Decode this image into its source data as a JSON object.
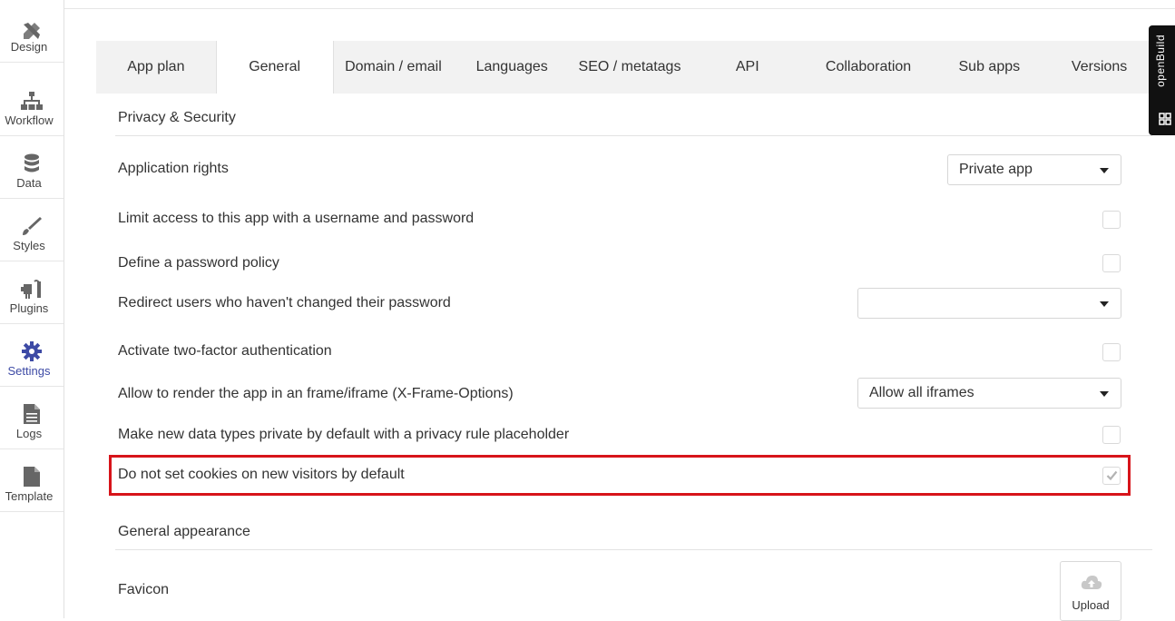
{
  "sidebar": {
    "items": [
      {
        "label": "Design",
        "icon": "design-icon"
      },
      {
        "label": "Workflow",
        "icon": "workflow-icon"
      },
      {
        "label": "Data",
        "icon": "database-icon"
      },
      {
        "label": "Styles",
        "icon": "brush-icon"
      },
      {
        "label": "Plugins",
        "icon": "plug-icon"
      },
      {
        "label": "Settings",
        "icon": "gear-icon",
        "active": true
      },
      {
        "label": "Logs",
        "icon": "document-icon"
      },
      {
        "label": "Template",
        "icon": "template-icon"
      }
    ]
  },
  "tabs": [
    {
      "label": "App plan"
    },
    {
      "label": "General",
      "active": true
    },
    {
      "label": "Domain / email"
    },
    {
      "label": "Languages"
    },
    {
      "label": "SEO / metatags"
    },
    {
      "label": "API"
    },
    {
      "label": "Collaboration"
    },
    {
      "label": "Sub apps"
    },
    {
      "label": "Versions"
    }
  ],
  "widget": {
    "label": "openBuild"
  },
  "privacy": {
    "title": "Privacy & Security",
    "application_rights": {
      "label": "Application rights",
      "value": "Private app"
    },
    "limit_access": {
      "label": "Limit access to this app with a username and password",
      "checked": false
    },
    "password_policy": {
      "label": "Define a password policy",
      "checked": false
    },
    "redirect_users": {
      "label": "Redirect users who haven't changed their password",
      "value": ""
    },
    "two_factor": {
      "label": "Activate two-factor authentication",
      "checked": false
    },
    "xframe": {
      "label": "Allow to render the app in an frame/iframe (X-Frame-Options)",
      "value": "Allow all iframes"
    },
    "private_types": {
      "label": "Make new data types private by default with a privacy rule placeholder",
      "checked": false
    },
    "no_cookies": {
      "label": "Do not set cookies on new visitors by default",
      "checked": true
    }
  },
  "appearance": {
    "title": "General appearance",
    "favicon": {
      "label": "Favicon",
      "upload_label": "Upload"
    }
  },
  "colors": {
    "accent": "#3d4aa5",
    "highlight": "#d7141a"
  }
}
